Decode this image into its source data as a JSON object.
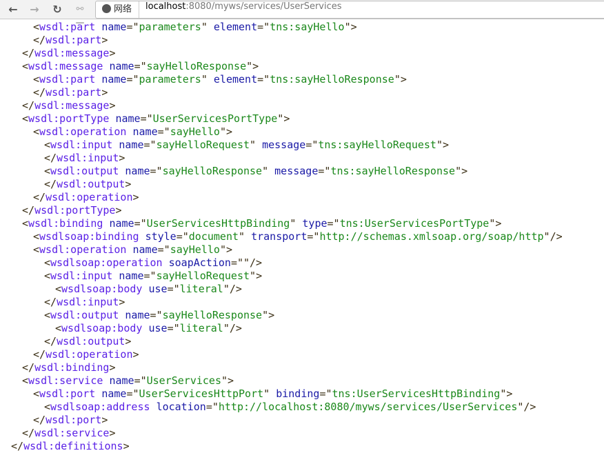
{
  "browser": {
    "back_icon": "arrow-left-icon",
    "forward_icon": "arrow-right-icon",
    "reload_icon": "reload-icon",
    "key_icon": "key-icon",
    "security_chip": "网络",
    "url_host": "localhost",
    "url_rest": ":8080/myws/services/UserServices"
  },
  "colors": {
    "bracket": "#3b2f15",
    "tag": "#5a20e6",
    "attr": "#1a1aa6",
    "value": "#1a881a"
  },
  "lines": [
    {
      "level": 2,
      "kind": "open",
      "tag": "wsdl:part",
      "attrs": [
        [
          "name",
          "parameters"
        ],
        [
          "element",
          "tns:sayHello"
        ]
      ]
    },
    {
      "level": 2,
      "kind": "close",
      "tag": "wsdl:part"
    },
    {
      "level": 1,
      "kind": "close",
      "tag": "wsdl:message"
    },
    {
      "level": 1,
      "kind": "open",
      "tag": "wsdl:message",
      "attrs": [
        [
          "name",
          "sayHelloResponse"
        ]
      ]
    },
    {
      "level": 2,
      "kind": "open",
      "tag": "wsdl:part",
      "attrs": [
        [
          "name",
          "parameters"
        ],
        [
          "element",
          "tns:sayHelloResponse"
        ]
      ]
    },
    {
      "level": 2,
      "kind": "close",
      "tag": "wsdl:part"
    },
    {
      "level": 1,
      "kind": "close",
      "tag": "wsdl:message"
    },
    {
      "level": 1,
      "kind": "open",
      "tag": "wsdl:portType",
      "attrs": [
        [
          "name",
          "UserServicesPortType"
        ]
      ]
    },
    {
      "level": 2,
      "kind": "open",
      "tag": "wsdl:operation",
      "attrs": [
        [
          "name",
          "sayHello"
        ]
      ]
    },
    {
      "level": 3,
      "kind": "open",
      "tag": "wsdl:input",
      "attrs": [
        [
          "name",
          "sayHelloRequest"
        ],
        [
          "message",
          "tns:sayHelloRequest"
        ]
      ]
    },
    {
      "level": 3,
      "kind": "close",
      "tag": "wsdl:input"
    },
    {
      "level": 3,
      "kind": "open",
      "tag": "wsdl:output",
      "attrs": [
        [
          "name",
          "sayHelloResponse"
        ],
        [
          "message",
          "tns:sayHelloResponse"
        ]
      ]
    },
    {
      "level": 3,
      "kind": "close",
      "tag": "wsdl:output"
    },
    {
      "level": 2,
      "kind": "close",
      "tag": "wsdl:operation"
    },
    {
      "level": 1,
      "kind": "close",
      "tag": "wsdl:portType"
    },
    {
      "level": 1,
      "kind": "open",
      "tag": "wsdl:binding",
      "attrs": [
        [
          "name",
          "UserServicesHttpBinding"
        ],
        [
          "type",
          "tns:UserServicesPortType"
        ]
      ]
    },
    {
      "level": 2,
      "kind": "self",
      "tag": "wsdlsoap:binding",
      "attrs": [
        [
          "style",
          "document"
        ],
        [
          "transport",
          "http://schemas.xmlsoap.org/soap/http"
        ]
      ]
    },
    {
      "level": 2,
      "kind": "open",
      "tag": "wsdl:operation",
      "attrs": [
        [
          "name",
          "sayHello"
        ]
      ]
    },
    {
      "level": 3,
      "kind": "self",
      "tag": "wsdlsoap:operation",
      "attrs": [
        [
          "soapAction",
          ""
        ]
      ]
    },
    {
      "level": 3,
      "kind": "open",
      "tag": "wsdl:input",
      "attrs": [
        [
          "name",
          "sayHelloRequest"
        ]
      ]
    },
    {
      "level": 4,
      "kind": "self",
      "tag": "wsdlsoap:body",
      "attrs": [
        [
          "use",
          "literal"
        ]
      ]
    },
    {
      "level": 3,
      "kind": "close",
      "tag": "wsdl:input"
    },
    {
      "level": 3,
      "kind": "open",
      "tag": "wsdl:output",
      "attrs": [
        [
          "name",
          "sayHelloResponse"
        ]
      ]
    },
    {
      "level": 4,
      "kind": "self",
      "tag": "wsdlsoap:body",
      "attrs": [
        [
          "use",
          "literal"
        ]
      ]
    },
    {
      "level": 3,
      "kind": "close",
      "tag": "wsdl:output"
    },
    {
      "level": 2,
      "kind": "close",
      "tag": "wsdl:operation"
    },
    {
      "level": 1,
      "kind": "close",
      "tag": "wsdl:binding"
    },
    {
      "level": 1,
      "kind": "open",
      "tag": "wsdl:service",
      "attrs": [
        [
          "name",
          "UserServices"
        ]
      ]
    },
    {
      "level": 2,
      "kind": "open",
      "tag": "wsdl:port",
      "attrs": [
        [
          "name",
          "UserServicesHttpPort"
        ],
        [
          "binding",
          "tns:UserServicesHttpBinding"
        ]
      ]
    },
    {
      "level": 3,
      "kind": "self",
      "tag": "wsdlsoap:address",
      "attrs": [
        [
          "location",
          "http://localhost:8080/myws/services/UserServices"
        ]
      ]
    },
    {
      "level": 2,
      "kind": "close",
      "tag": "wsdl:port"
    },
    {
      "level": 1,
      "kind": "close",
      "tag": "wsdl:service"
    },
    {
      "level": 0,
      "kind": "close",
      "tag": "wsdl:definitions"
    }
  ]
}
